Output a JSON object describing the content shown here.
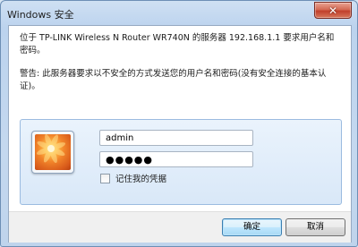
{
  "window": {
    "title": "Windows 安全",
    "close_glyph": "✕"
  },
  "dialog": {
    "message_line1": "位于 TP-LINK Wireless N Router WR740N 的服务器 192.168.1.1 要求用户名和密码。",
    "warning": "警告: 此服务器要求以不安全的方式发送您的用户名和密码(没有安全连接的基本认证)。"
  },
  "credentials": {
    "username_value": "admin",
    "password_value": "●●●●●",
    "remember_label": "记住我的凭据",
    "remember_checked": false,
    "avatar_icon": "flower-avatar-icon"
  },
  "buttons": {
    "ok_label": "确定",
    "cancel_label": "取消"
  }
}
